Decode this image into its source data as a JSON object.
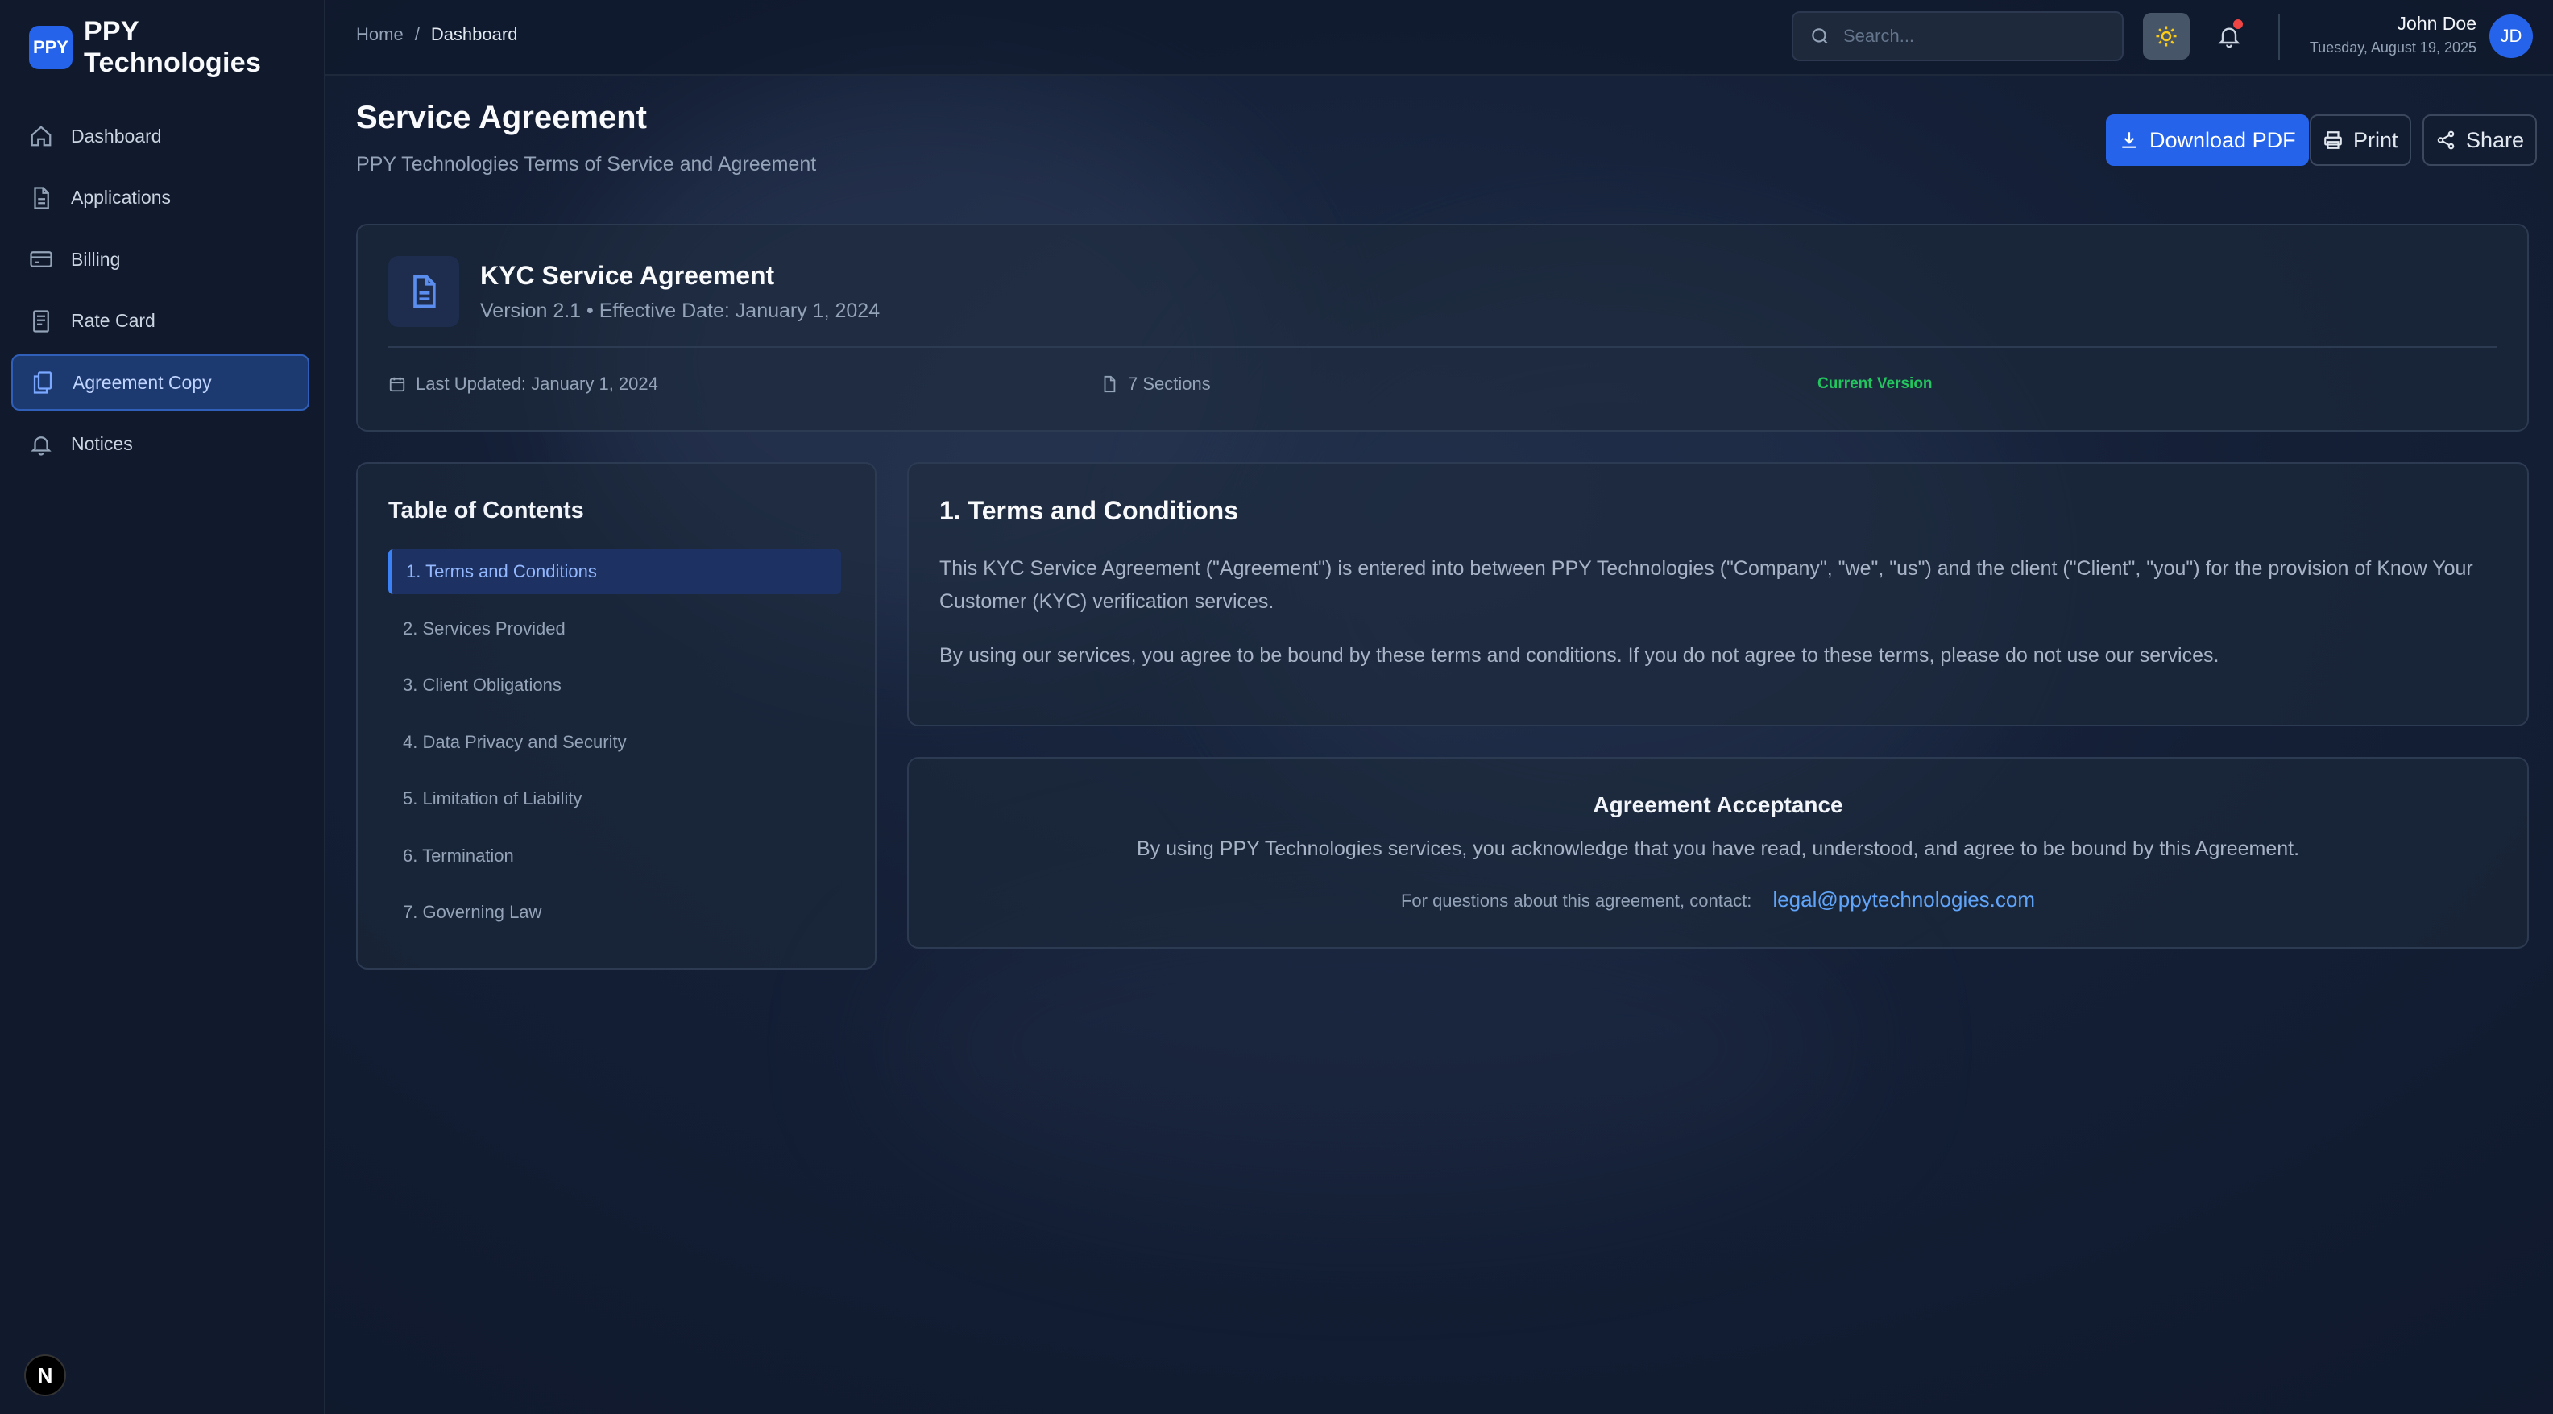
{
  "brand": {
    "logo": "PPY",
    "name": "PPY Technologies"
  },
  "sidebar": {
    "items": [
      {
        "label": "Dashboard",
        "icon": "home-icon"
      },
      {
        "label": "Applications",
        "icon": "file-icon"
      },
      {
        "label": "Billing",
        "icon": "credit-card-icon"
      },
      {
        "label": "Rate Card",
        "icon": "receipt-icon"
      },
      {
        "label": "Agreement Copy",
        "icon": "copy-icon",
        "active": true
      },
      {
        "label": "Notices",
        "icon": "bell-icon"
      }
    ],
    "badge": "N"
  },
  "topbar": {
    "breadcrumb": [
      "Home",
      "/",
      "Dashboard"
    ],
    "search_placeholder": "Search...",
    "user_name": "John Doe",
    "user_date": "Tuesday, August 19, 2025",
    "avatar": "JD"
  },
  "header": {
    "title": "Service Agreement",
    "subtitle": "PPY Technologies Terms of Service and Agreement",
    "download_label": "Download PDF",
    "print_label": "Print",
    "share_label": "Share"
  },
  "doc_card": {
    "title": "KYC Service Agreement",
    "meta": "Version 2.1 • Effective Date: January 1, 2024",
    "last_updated": "Last Updated: January 1, 2024",
    "sections": "7 Sections",
    "status": "Current Version"
  },
  "toc": {
    "title": "Table of Contents",
    "items": [
      "1. Terms and Conditions",
      "2. Services Provided",
      "3. Client Obligations",
      "4. Data Privacy and Security",
      "5. Limitation of Liability",
      "6. Termination",
      "7. Governing Law"
    ]
  },
  "section": {
    "title": "1. Terms and Conditions",
    "para1": "This KYC Service Agreement (\"Agreement\") is entered into between PPY Technologies (\"Company\", \"we\", \"us\") and the client (\"Client\", \"you\") for the provision of Know Your Customer (KYC) verification services.",
    "para2": "By using our services, you agree to be bound by these terms and conditions. If you do not agree to these terms, please do not use our services."
  },
  "acceptance": {
    "title": "Agreement Acceptance",
    "text": "By using PPY Technologies services, you acknowledge that you have read, understood, and agree to be bound by this Agreement.",
    "contact_prefix": "For questions about this agreement, contact:",
    "contact_email": "legal@ppytechnologies.com"
  },
  "colors": {
    "accent": "#2563eb",
    "status": "#22c55e",
    "link": "#60a5fa"
  }
}
